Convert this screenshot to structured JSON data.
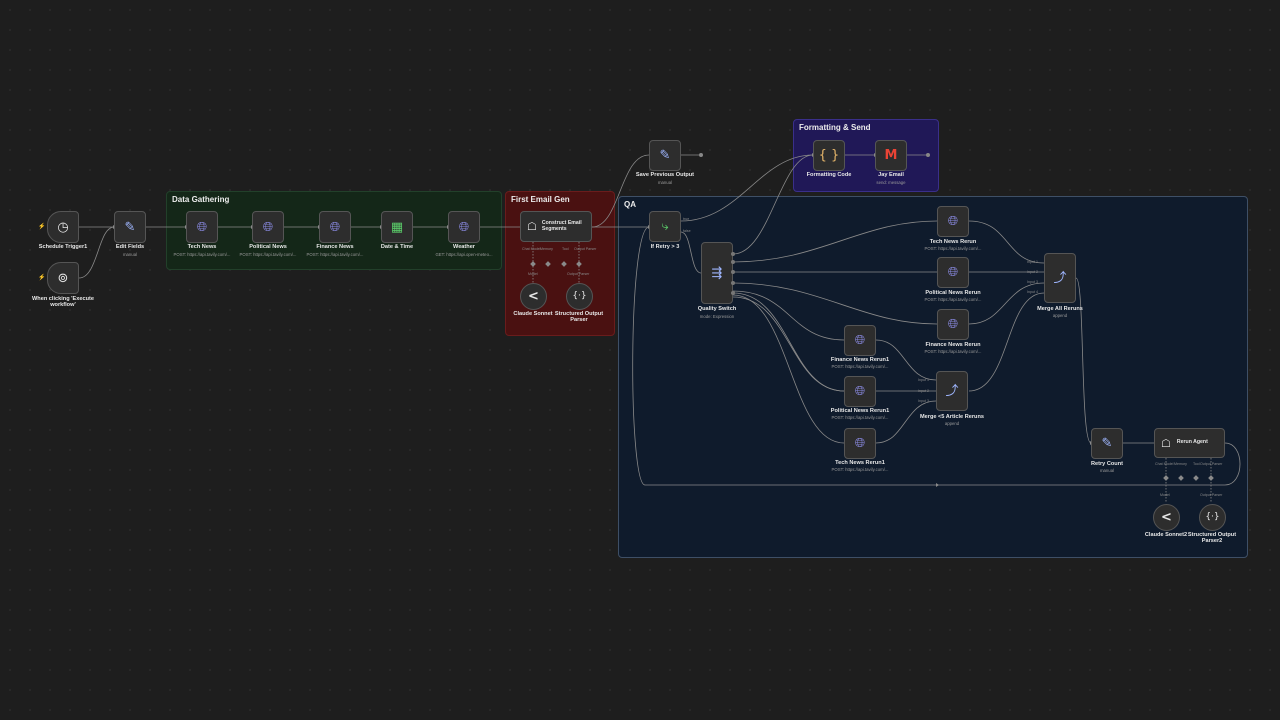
{
  "groups": {
    "data_gathering": "Data Gathering",
    "first_email_gen": "First Email Gen",
    "qa": "QA",
    "formatting_send": "Formatting & Send"
  },
  "nodes": {
    "schedule_trigger": {
      "label": "Schedule Trigger1"
    },
    "manual_trigger": {
      "label": "When clicking 'Execute workflow'"
    },
    "edit_fields": {
      "label": "Edit Fields",
      "sub": "manual"
    },
    "tech_news": {
      "label": "Tech News",
      "sub": "POST: https://api.tavily.com/..."
    },
    "political_news": {
      "label": "Political News",
      "sub": "POST: https://api.tavily.com/..."
    },
    "finance_news": {
      "label": "Finance News",
      "sub": "POST: https://api.tavily.com/..."
    },
    "date_time": {
      "label": "Date & Time"
    },
    "weather": {
      "label": "Weather",
      "sub": "GET: https://api.open-meteo..."
    },
    "construct_email": {
      "label": "Construct Email Segments",
      "ports": [
        "Chat Model",
        "Memory",
        "Tool",
        "Output Parser"
      ]
    },
    "claude_sonnet": {
      "label": "Claude Sonnet",
      "port": "Model"
    },
    "structured_parser": {
      "label": "Structured Output Parser",
      "port": "Output Parser"
    },
    "save_previous": {
      "label": "Save Previous Output",
      "sub": "manual"
    },
    "if_retry": {
      "label": "If Retry > 3",
      "true_label": "true",
      "false_label": "false"
    },
    "quality_switch": {
      "label": "Quality Switch",
      "sub": "mode: Expression"
    },
    "formatting_code": {
      "label": "Formatting Code"
    },
    "jay_email": {
      "label": "Jay Email",
      "sub": "send: message"
    },
    "tech_rerun": {
      "label": "Tech News Rerun",
      "sub": "POST: https://api.tavily.com/..."
    },
    "political_rerun": {
      "label": "Political News Rerun",
      "sub": "POST: https://api.tavily.com/..."
    },
    "finance_rerun": {
      "label": "Finance News Rerun",
      "sub": "POST: https://api.tavily.com/..."
    },
    "finance_rerun1": {
      "label": "Finance News Rerun1",
      "sub": "POST: https://api.tavily.com/..."
    },
    "political_rerun1": {
      "label": "Political News Rerun1",
      "sub": "POST: https://api.tavily.com/..."
    },
    "tech_rerun1": {
      "label": "Tech News Rerun1",
      "sub": "POST: https://api.tavily.com/..."
    },
    "merge_all": {
      "label": "Merge All Reruns",
      "sub": "append",
      "inputs": [
        "Input 1",
        "Input 2",
        "Input 3",
        "Input 4"
      ]
    },
    "merge_lt5": {
      "label": "Merge <5 Article Reruns",
      "sub": "append",
      "inputs": [
        "Input 1",
        "Input 2",
        "Input 3"
      ]
    },
    "retry_count": {
      "label": "Retry Count",
      "sub": "manual"
    },
    "rerun_agent": {
      "label": "Rerun Agent",
      "ports": [
        "Chat Model",
        "Memory",
        "Tool",
        "Output Parser"
      ]
    },
    "claude_sonnet2": {
      "label": "Claude Sonnet2",
      "port": "Model"
    },
    "structured_parser2": {
      "label": "Structured Output Parser2",
      "port": "Output Parser"
    }
  },
  "icons": {
    "clock": "clock-icon",
    "cursor": "cursor-click-icon",
    "pencil": "pencil-icon",
    "globe": "globe-icon",
    "calendar": "calendar-icon",
    "robot": "robot-icon",
    "claude": "claude-icon",
    "parser": "braces-icon",
    "branch": "branch-icon",
    "switch": "switch-icon",
    "code": "code-braces-icon",
    "gmail": "gmail-icon",
    "merge": "merge-icon"
  },
  "colors": {
    "canvas": "#1e1e1e",
    "data_group": "#142718",
    "email_group": "#4a1111",
    "qa_group": "#0f1b2c",
    "format_group": "#201857",
    "node": "#2d2d2d",
    "http_icon": "#8d8de8",
    "trigger_bolt": "#ff6d5a"
  }
}
